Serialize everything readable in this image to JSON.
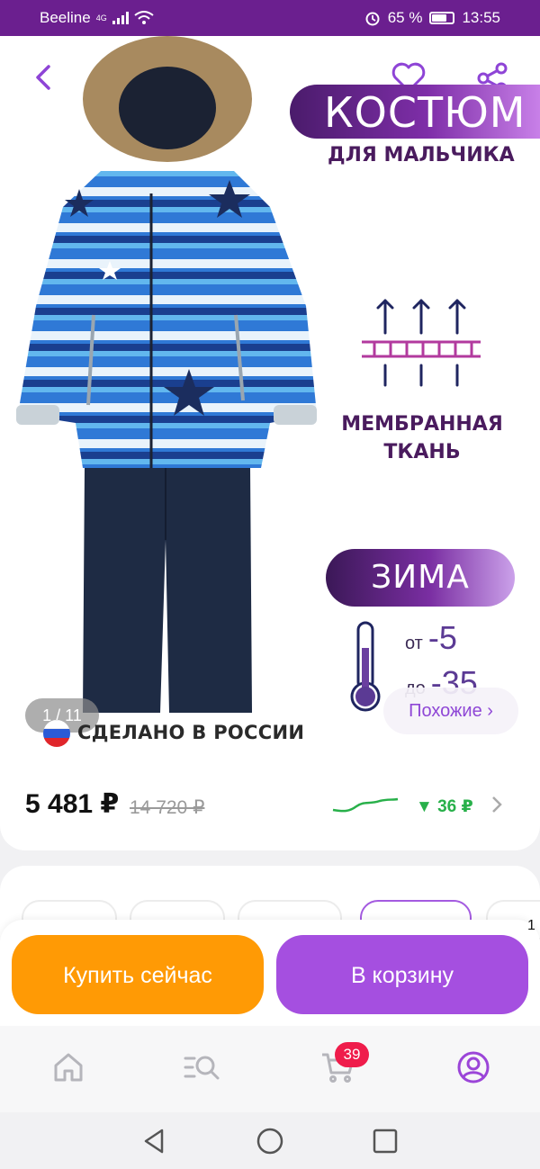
{
  "status_bar": {
    "carrier": "Beeline",
    "network": "4G",
    "battery_percent": "65 %",
    "battery_level": 0.65,
    "time": "13:55"
  },
  "product": {
    "title_main": "КОСТЮМ",
    "title_sub": "ДЛЯ МАЛЬЧИКА",
    "feature_line1": "МЕМБРАННАЯ",
    "feature_line2": "ТКАНЬ",
    "season": "ЗИМА",
    "temp_from_label": "от",
    "temp_from_value": "-5",
    "temp_to_label": "до",
    "temp_to_value": "-35",
    "image_counter": "1 / 11",
    "similar_label": "Похожие ›",
    "made_in": "СДЕЛАНО В РОССИИ",
    "price_current": "5 481 ₽",
    "price_old": "14 720 ₽",
    "price_drop": "▼ 36 ₽"
  },
  "actions": {
    "buy_now": "Купить сейчас",
    "add_to_cart": "В корзину",
    "edge_number": "1"
  },
  "nav": {
    "cart_count": "39",
    "items": [
      "home-icon",
      "catalog-search-icon",
      "cart-icon",
      "profile-icon"
    ]
  },
  "colors": {
    "status_bar": "#6b1f8f",
    "accent_purple": "#a54fe0",
    "buy_orange": "#ff9a05",
    "badge_red": "#ef1c4b",
    "price_drop_green": "#28b04a"
  }
}
